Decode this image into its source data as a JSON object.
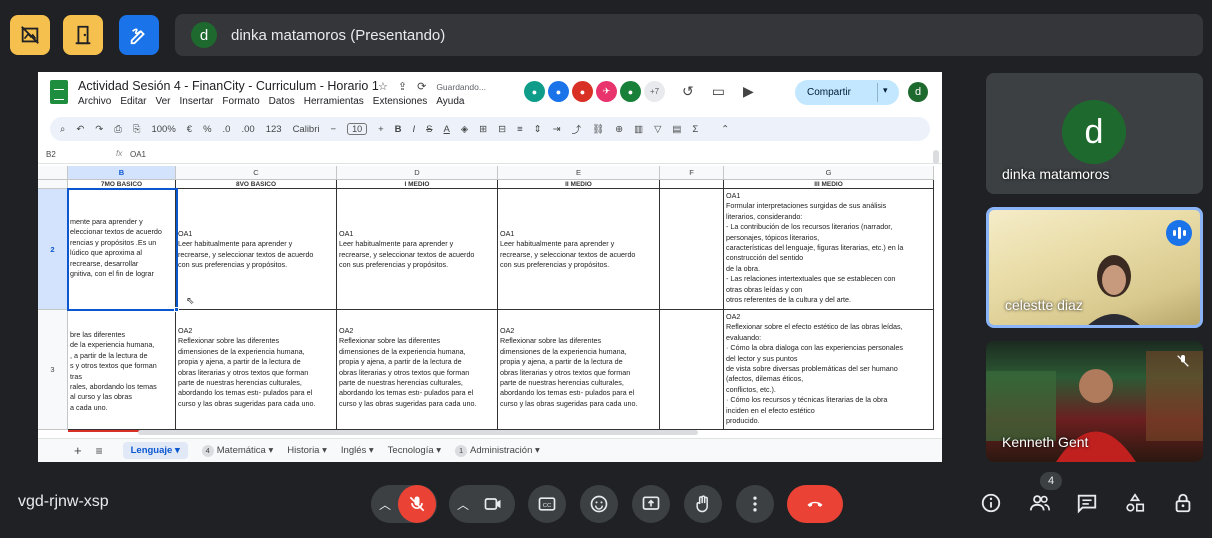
{
  "presenting_bar": {
    "avatar_letter": "d",
    "text": "dinka matamoros (Presentando)"
  },
  "top_buttons": [
    {
      "icon": "no-image-icon",
      "color": "#f6c04e"
    },
    {
      "icon": "exit-door-icon",
      "color": "#f6c04e"
    },
    {
      "icon": "pen-scribble-icon",
      "color": "#1a73e8"
    }
  ],
  "sheet": {
    "title": "Actividad Sesión 4 - FinanCity - Curriculum - Horario 1",
    "saving": "Guardando...",
    "menu": [
      "Archivo",
      "Editar",
      "Ver",
      "Insertar",
      "Formato",
      "Datos",
      "Herramientas",
      "Extensiones",
      "Ayuda"
    ],
    "collaborators_more": "+7",
    "share_label": "Compartir",
    "avatar_letter": "d",
    "toolbar": {
      "zoom": "100%",
      "currency": "€",
      "percent": "%",
      "dec_less": ".0",
      "dec_more": ".00",
      "format_num": "123",
      "font": "Calibri",
      "font_size": "10"
    },
    "cell_ref": "B2",
    "formula_value": "OA1",
    "columns": [
      "B",
      "C",
      "D",
      "E",
      "F",
      "G"
    ],
    "header_labels": [
      "7MO BASICO",
      "8VO BASICO",
      "I MEDIO",
      "II MEDIO",
      "",
      "III MEDIO"
    ],
    "rows": [
      {
        "num": "2",
        "cells": [
          "mente para aprender y\neleccionar textos de acuerdo\nrencias y propósitos  .Es un\nlúdico que aproxima al\nrecrearse, desarrollar\ngnitiva, con el fin de lograr",
          "OA1\nLeer habitualmente para aprender y\nrecrearse, y seleccionar textos de acuerdo\ncon sus preferencias y propósitos.",
          "OA1\nLeer habitualmente para aprender y\nrecrearse, y seleccionar textos de acuerdo\ncon sus preferencias y propósitos.",
          "OA1\nLeer habitualmente para aprender y\nrecrearse, y seleccionar textos de acuerdo\ncon sus preferencias y propósitos.",
          "",
          "OA1\nFormular interpretaciones surgidas de sus análisis\nliterarios, considerando:\n- La contribución de los recursos literarios (narrador,\npersonajes, tópicos literarios,\ncaracterísticas del lenguaje, figuras literarias, etc.) en la\nconstrucción del sentido\nde la obra.\n- Las relaciones intertextuales que se establecen con\notras obras leídas y con\notros referentes de la cultura y del arte."
        ]
      },
      {
        "num": "3",
        "cells": [
          "bre las diferentes\nde la experiencia humana,\n, a partir de la lectura de\ns y otros textos que forman\ntras\nrales, abordando los temas\nal curso y las obras\na cada uno.",
          "OA2\nReflexionar sobre las diferentes\ndimensiones de la experiencia humana,\npropia y ajena, a partir de la lectura de\nobras literarias y otros textos que forman\nparte de nuestras herencias culturales,\nabordando los temas estı- pulados para el\ncurso y las obras sugeridas para cada uno.",
          "OA2\nReflexionar sobre las diferentes\ndimensiones de la experiencia humana,\npropia y ajena, a partir de la lectura de\nobras literarias y otros textos que forman\nparte de nuestras herencias culturales,\nabordando los temas estı- pulados para el\ncurso y las obras sugeridas para cada uno.",
          "OA2\nReflexionar sobre las diferentes\ndimensiones de la experiencia humana,\npropia y ajena, a partir de la lectura de\nobras literarias y otros textos que forman\nparte de nuestras herencias culturales,\nabordando los temas estı- pulados para el\ncurso y las obras sugeridas para cada uno.",
          "",
          "OA2\nReflexionar sobre el efecto estético de las obras leídas,\nevaluando:\n· Cómo la obra dialoga con las experiencias personales\ndel lector y sus puntos\nde vista sobre diversas problemáticas del ser humano\n(afectos, dilemas éticos,\nconflictos, etc.).\n· Cómo los recursos y técnicas literarias de la obra\ninciden en el efecto estético\nproducido."
        ]
      }
    ],
    "tabs": [
      {
        "label": "Lenguaje",
        "num": "",
        "active": true
      },
      {
        "label": "Matemática",
        "num": "4",
        "active": false
      },
      {
        "label": "Historia",
        "num": "",
        "active": false
      },
      {
        "label": "Inglés",
        "num": "",
        "active": false
      },
      {
        "label": "Tecnología",
        "num": "",
        "active": false
      },
      {
        "label": "Administración",
        "num": "1",
        "active": false
      }
    ]
  },
  "participants": [
    {
      "name": "dinka matamoros",
      "avatar_letter": "d"
    },
    {
      "name": "celestte diaz"
    },
    {
      "name": "Kenneth Gent"
    }
  ],
  "meeting_code": "vgd-rjnw-xsp",
  "people_count": "4",
  "colors": {
    "end_call": "#ea4335",
    "accent": "#1a73e8",
    "sheet_green": "#1e8e3e"
  }
}
